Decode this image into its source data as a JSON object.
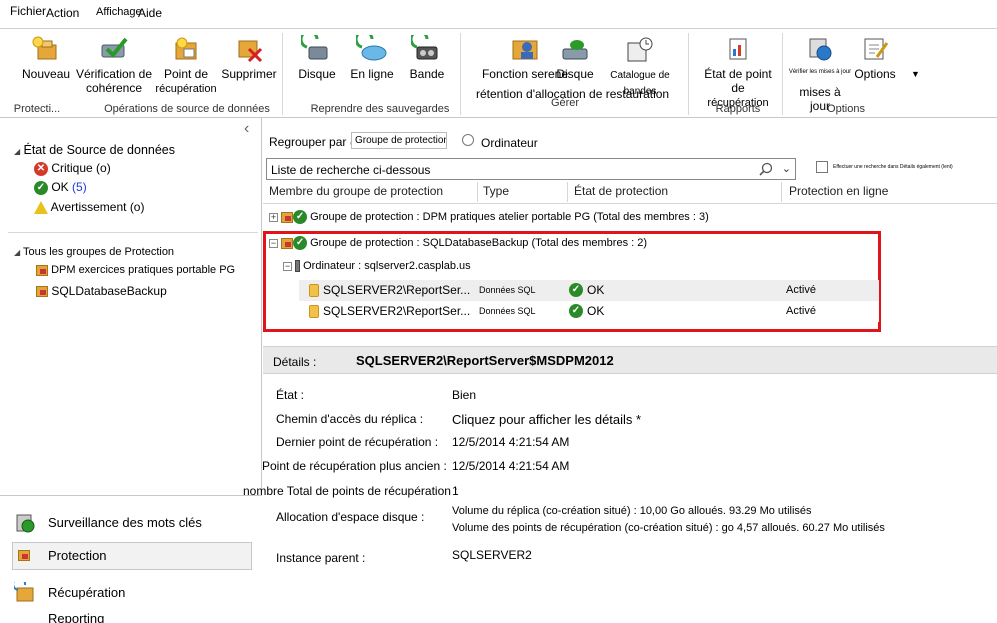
{
  "menu": {
    "fichier": "Fichier",
    "action": "Action",
    "affichage": "Affichage",
    "aide": "Aide"
  },
  "ribbon": {
    "buttons": {
      "nouveau": "Nouveau",
      "verification1": "Vérification de",
      "verification2": "cohérence",
      "point1": "Point de",
      "point2": "récupération",
      "supprimer": "Supprimer",
      "disque": "Disque",
      "en_ligne": "En ligne",
      "bande": "Bande",
      "fonction1": "Fonction serene",
      "fonction2": "rétention d'allocation de restauration",
      "disque2": "Disque",
      "catalogue": "Catalogue de bandes",
      "etat1": "État de point de",
      "etat2": "récupération",
      "verifier_small": "Vérifier les mises à jour",
      "mises_a_jour": "mises à jour",
      "options": "Options"
    },
    "groups": {
      "protection": "Protecti...",
      "operations": "Opérations de source de données",
      "reprendre": "Reprendre des sauvegardes",
      "gerer": "Gérer",
      "rapports": "Rapports",
      "options": "Options"
    }
  },
  "left": {
    "status_header": "État de Source de données",
    "critique": "Critique (o)",
    "ok_label": "OK",
    "ok_count": "(5)",
    "avertissement": "Avertissement (o)",
    "all_groups": "Tous les groupes de Protection",
    "group1": "DPM exercices pratiques portable PG",
    "group2": "SQLDatabaseBackup",
    "collapse_glyph": "‹"
  },
  "nav": {
    "surveillance": "Surveillance des mots clés",
    "protection": "Protection",
    "recuperation": "Récupération",
    "reporting": "Reporting"
  },
  "toolbar": {
    "regrouper": "Regrouper par @",
    "groupe_protection": "Groupe de protection",
    "ordinateur": "Ordinateur",
    "search_placeholder": "Liste de recherche ci-dessous",
    "also_search": "Effectuer une recherche dans Détails également (lent)"
  },
  "columns": {
    "membre": "Membre du groupe de protection",
    "type": "Type",
    "etat": "État de protection",
    "en_ligne": "Protection en ligne"
  },
  "grid": {
    "group1": "Groupe de protection : DPM pratiques atelier portable PG (Total des membres : 3)",
    "group2": "Groupe de protection : SQLDatabaseBackup (Total des membres : 2)",
    "computer": "Ordinateur : sqlserver2.casplab.us",
    "rows": [
      {
        "name": "SQLSERVER2\\ReportSer...",
        "type": "Données SQL",
        "status": "OK",
        "online": "Activé"
      },
      {
        "name": "SQLSERVER2\\ReportSer...",
        "type": "Données SQL",
        "status": "OK",
        "online": "Activé"
      }
    ]
  },
  "details": {
    "label": "Détails :",
    "title": "SQLSERVER2\\ReportServer$MSDPM2012",
    "etat_lbl": "État :",
    "etat_val": "Bien",
    "chemin_lbl": "Chemin d'accès du réplica :",
    "chemin_val": "Cliquez pour afficher les détails *",
    "dernier_lbl": "Dernier point de récupération :",
    "dernier_val": "12/5/2014 4:21:54 AM",
    "ancien_lbl": "Point de récupération plus ancien :",
    "ancien_val": "12/5/2014 4:21:54 AM",
    "total_lbl": "nombre Total de points de récupération :",
    "total_val": "1",
    "alloc_lbl": "Allocation d'espace disque :",
    "alloc_val1": "Volume du réplica (co-création situé) : 10,00 Go alloués. 93.29 Mo utilisés",
    "alloc_val2": "Volume des points de récupération (co-création situé) : go 4,57 alloués. 60.27 Mo utilisés",
    "instance_lbl": "Instance parent :",
    "instance_val": "SQLSERVER2"
  },
  "colors": {
    "highlight_border": "#e0151b",
    "selected_row": "#eeeeee",
    "details_bar": "#e9e9e9"
  }
}
